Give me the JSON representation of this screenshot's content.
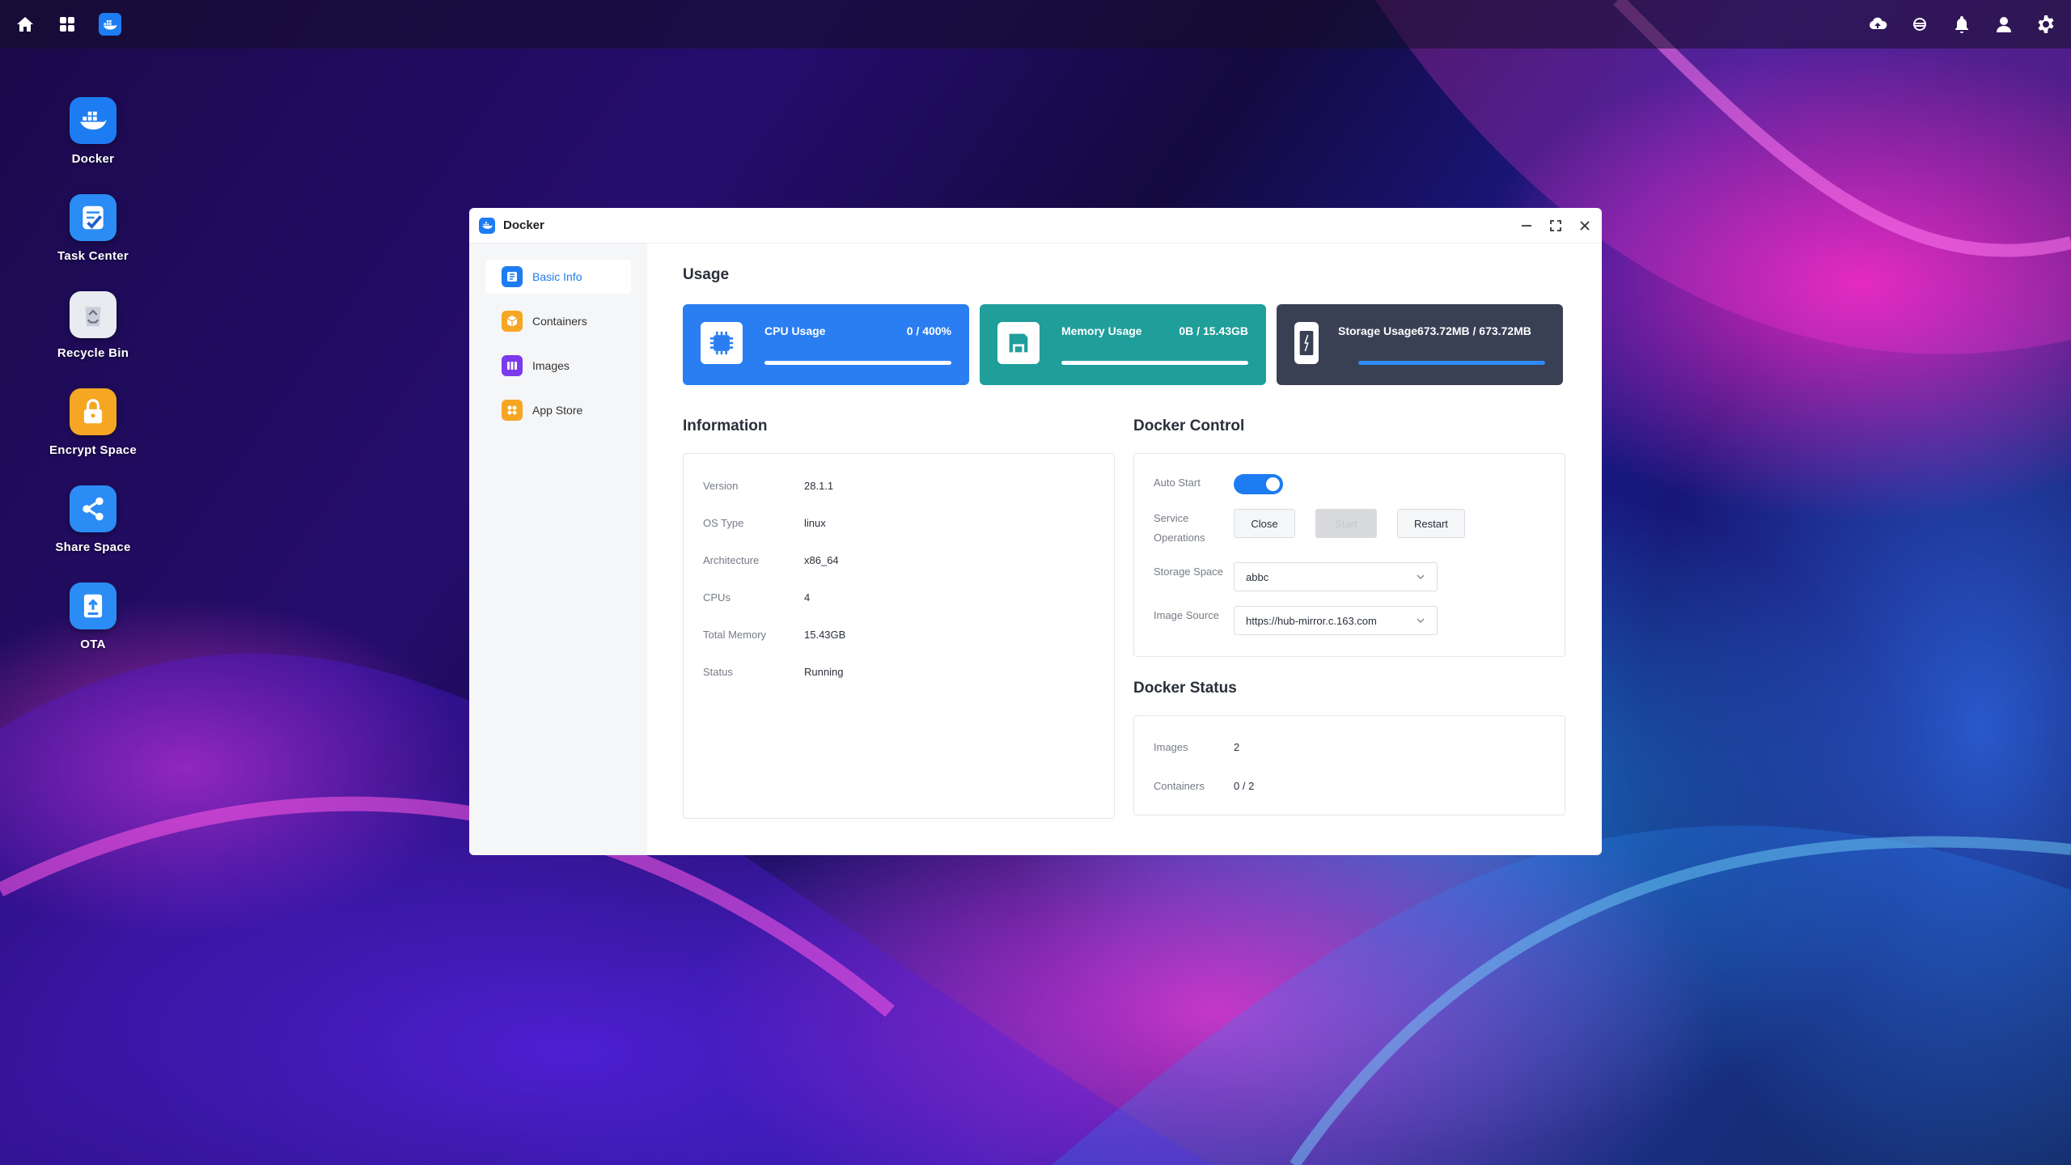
{
  "topbar": {
    "left_icons": [
      "home-icon",
      "apps-grid-icon",
      "docker-taskbar-icon"
    ],
    "right_icons": [
      "cloud-upload-icon",
      "link-icon",
      "bell-icon",
      "user-icon",
      "gear-icon"
    ]
  },
  "desktop": {
    "items": [
      {
        "label": "Docker",
        "icon": "docker-icon",
        "color": "#1d7cf2"
      },
      {
        "label": "Task Center",
        "icon": "task-center-icon",
        "color": "#2a8cf4"
      },
      {
        "label": "Recycle Bin",
        "icon": "recycle-bin-icon",
        "color": "#e8ebf0"
      },
      {
        "label": "Encrypt Space",
        "icon": "lock-icon",
        "color": "#f5a623"
      },
      {
        "label": "Share Space",
        "icon": "share-icon",
        "color": "#2a8cf4"
      },
      {
        "label": "OTA",
        "icon": "ota-icon",
        "color": "#2a8cf4"
      }
    ]
  },
  "window": {
    "title": "Docker",
    "controls": [
      "minimize-icon",
      "maximize-icon",
      "close-icon"
    ]
  },
  "sidebar": {
    "items": [
      {
        "label": "Basic Info",
        "active": true,
        "icon": "basic-info-icon",
        "color": "#1d7cf2"
      },
      {
        "label": "Containers",
        "active": false,
        "icon": "containers-icon",
        "color": "#f5a623"
      },
      {
        "label": "Images",
        "active": false,
        "icon": "images-icon",
        "color": "#7c3aed"
      },
      {
        "label": "App Store",
        "active": false,
        "icon": "app-store-icon",
        "color": "#f5a623"
      }
    ]
  },
  "usage": {
    "title": "Usage",
    "cards": [
      {
        "label": "CPU Usage",
        "value": "0 / 400%",
        "fraction": 1.0,
        "color": "#2a7ef2",
        "icon": "cpu-icon"
      },
      {
        "label": "Memory Usage",
        "value": "0B / 15.43GB",
        "fraction": 1.0,
        "color": "#1f9e9a",
        "icon": "memory-icon"
      },
      {
        "label": "Storage Usage",
        "value": "673.72MB / 673.72MB",
        "fraction": 1.0,
        "color": "#3a4054",
        "icon": "storage-icon"
      }
    ]
  },
  "information": {
    "title": "Information",
    "rows": [
      {
        "key": "Version",
        "value": "28.1.1"
      },
      {
        "key": "OS Type",
        "value": "linux"
      },
      {
        "key": "Architecture",
        "value": "x86_64"
      },
      {
        "key": "CPUs",
        "value": "4"
      },
      {
        "key": "Total Memory",
        "value": "15.43GB"
      },
      {
        "key": "Status",
        "value": "Running"
      }
    ]
  },
  "control": {
    "title": "Docker Control",
    "auto_start_label": "Auto Start",
    "auto_start": true,
    "service_label": "Service Operations",
    "buttons": {
      "close": "Close",
      "start": "Start",
      "restart": "Restart"
    },
    "storage_label": "Storage Space",
    "storage_value": "abbc",
    "image_source_label": "Image Source",
    "image_source_value": "https://hub-mirror.c.163.com"
  },
  "status": {
    "title": "Docker Status",
    "rows": [
      {
        "key": "Images",
        "value": "2"
      },
      {
        "key": "Containers",
        "value": "0 / 2"
      }
    ]
  }
}
